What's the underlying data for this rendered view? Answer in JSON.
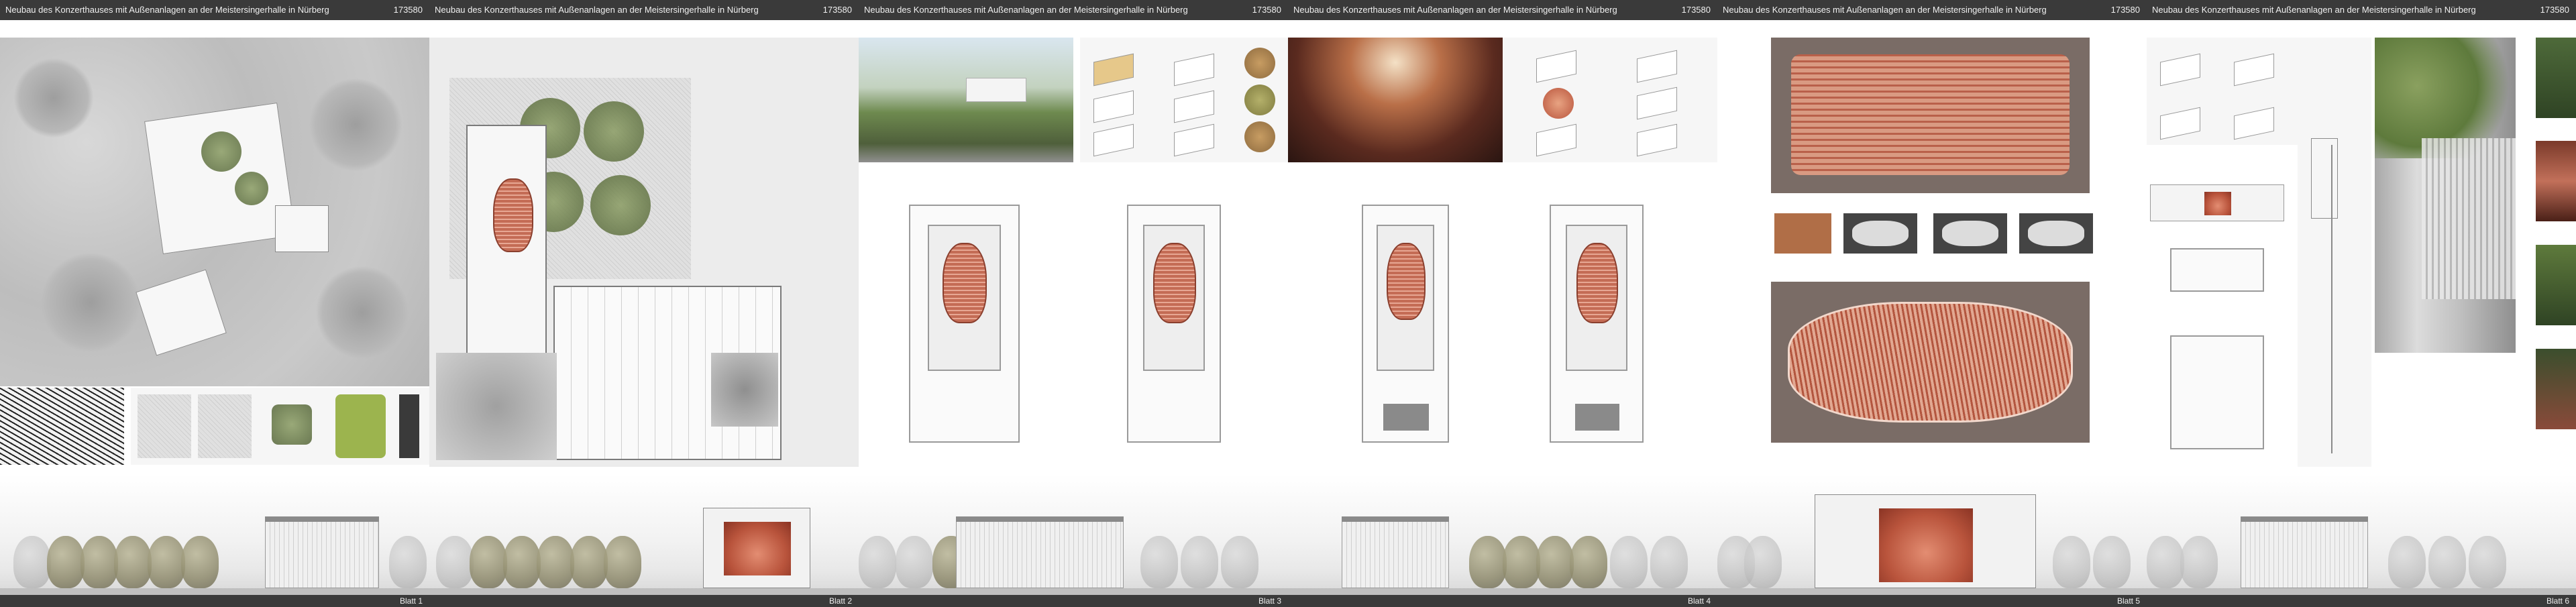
{
  "header": {
    "title": "Neubau des Konzerthauses mit Außenanlagen an der Meistersingerhalle in Nürberg",
    "number": "173580"
  },
  "sheets": [
    {
      "label": "Blatt 1"
    },
    {
      "label": "Blatt 2"
    },
    {
      "label": "Blatt 3"
    },
    {
      "label": "Blatt 4"
    },
    {
      "label": "Blatt 5"
    },
    {
      "label": "Blatt 6"
    }
  ],
  "colors": {
    "bar": "#3a3a3a",
    "hall_red": "#b9543c",
    "planting": "#6f8050"
  }
}
